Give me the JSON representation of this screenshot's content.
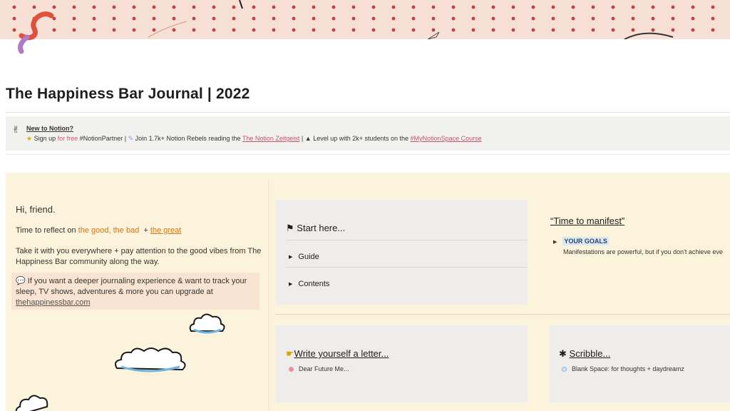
{
  "page": {
    "title": "The Happiness Bar Journal | 2022"
  },
  "callout": {
    "icon": "victory-hand-icon",
    "heading": "New to Notion?",
    "sign_up_prefix": "Sign up",
    "for_free": "for free",
    "partner": "#NotionPartner |",
    "join_text": "Join 1.7k+ Notion Rebels reading the",
    "zeitgeist": "The Notion Zeitgeist",
    "level_up_text": "Level up with 2k+ students on the",
    "course": "#MyNotionSpace Course"
  },
  "intro": {
    "greeting": "Hi, friend.",
    "reflect_prefix": "Time to reflect on",
    "good": "the good",
    "bad": "the bad",
    "great": "the great",
    "take_it": "Take it with you everywhere + pay attention to the good vibes from The Happiness Bar community along the way.",
    "upgrade_text": "If you want a deeper journaling experience &  want to track your sleep, TV shows, adventures & more you can upgrade at",
    "upgrade_link": "thehappinessbar.com"
  },
  "start_here": {
    "heading": "Start here...",
    "items": [
      "Guide",
      "Contents"
    ]
  },
  "manifest": {
    "heading": "“Time to manifest”",
    "goals_label": "YOUR GOALS",
    "goals_desc": "Manifestations are powerful, but if you don't achieve eve"
  },
  "letter": {
    "heading": "Write yourself a  letter...",
    "item": "Dear Future Me..."
  },
  "scribble": {
    "heading": "Scribble...",
    "item": "Blank Space: for thoughts + daydreamz"
  },
  "colors": {
    "accent_orange": "#d9730d",
    "link_pink": "#d4557a",
    "panel_yellow": "#fbf3db",
    "card_gray": "#eeedeb"
  }
}
